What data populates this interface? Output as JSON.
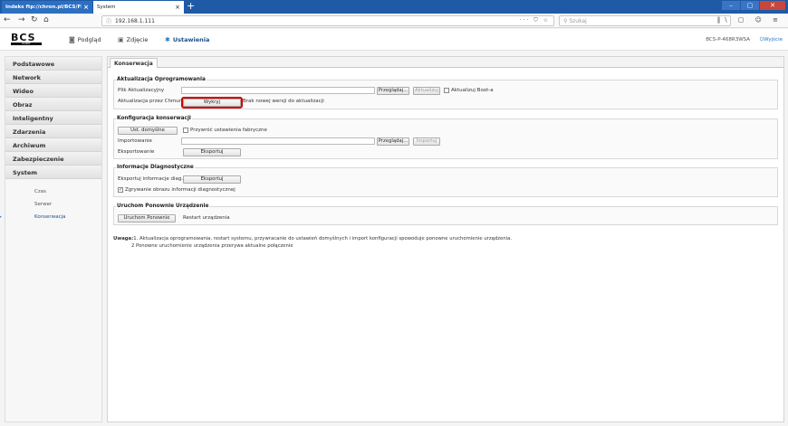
{
  "browser": {
    "tabs": [
      {
        "label": "Indeks ftp://chron.pl/BCS/FIRM",
        "close": "×"
      },
      {
        "label": "System",
        "close": "×"
      }
    ],
    "new_tab": "+",
    "url": "192.168.1.111",
    "url_tools": "··· ⛉ ☆",
    "search_placeholder": "Szukaj",
    "window_buttons": [
      "–",
      "▢",
      "✕"
    ],
    "nav_icons": {
      "back": "←",
      "forward": "→",
      "reload": "↻",
      "home": "⌂",
      "right": "‖\\ ▢ ☺ ≡"
    }
  },
  "header": {
    "logo_text": "BCS",
    "logo_sub": "POINT",
    "nav": [
      {
        "label": "Podgląd",
        "icon": "camera-icon",
        "glyph": "◙"
      },
      {
        "label": "Zdjęcie",
        "icon": "picture-icon",
        "glyph": "▣"
      },
      {
        "label": "Ustawienia",
        "icon": "gear-icon",
        "glyph": "✱"
      }
    ],
    "device_name": "BCS-P-468R3WSA",
    "logout": "Wyjście",
    "logout_glyph": "⏻"
  },
  "sidebar": {
    "categories": [
      "Podstawowe",
      "Network",
      "Wideo",
      "Obraz",
      "Inteligentny",
      "Zdarzenia",
      "Archiwum",
      "Zabezpieczenie",
      "System"
    ],
    "subitems": [
      "Czas",
      "Serwer",
      "Konserwacja"
    ],
    "active_subitem": "Konserwacja",
    "active_glyph": "▶"
  },
  "content": {
    "tab": "Konserwacja",
    "update": {
      "title": "Aktualizacja Oprogramowania",
      "file_label": "Plik Aktualizacyjny",
      "file_value": "",
      "browse": "Przeglądaj...",
      "update_btn": "Aktualizuj",
      "boot_label": "Aktualizuj Boot-a",
      "cloud_label": "Aktualizacja przez Chmurę",
      "detect_btn": "Wykryj",
      "cloud_status": "Brak nowej wersji do aktualizacji"
    },
    "config": {
      "title": "Konfiguracja konserwacji",
      "defaults_btn": "Ust. domyślne",
      "factory_label": "Przywróć ustawienia fabryczne",
      "import_label": "Importowanie",
      "import_value": "",
      "browse": "Przeglądaj...",
      "import_btn": "Importuj",
      "export_label": "Eksportowanie",
      "export_btn": "Eksportuj"
    },
    "diag": {
      "title": "Informacje Diagnostyczne",
      "export_label": "Eksportuj informacje diag...",
      "export_btn": "Eksportuj",
      "capture_label": "Zgrywanie obrazu informacji diagnostycznej",
      "capture_checked": "✓"
    },
    "restart": {
      "title": "Uruchom Ponownie Urządzenie",
      "restart_btn": "Uruchom Ponownie",
      "restart_label": "Restart urządzenia"
    },
    "note": {
      "prefix": "Uwaga:",
      "line1": "1. Aktualizacja oprogramowania, restart systemu, przywracanie do ustawień domyślnych i import konfiguracji spowoduje ponowne uruchomienie urządzenia.",
      "line2": "2 Ponowne uruchomienie urządzenia przerywa aktualne połączenie"
    }
  },
  "colors": {
    "accent": "#2b74c9",
    "titlebar": "#1f5aa6",
    "highlight": "#d10000"
  }
}
